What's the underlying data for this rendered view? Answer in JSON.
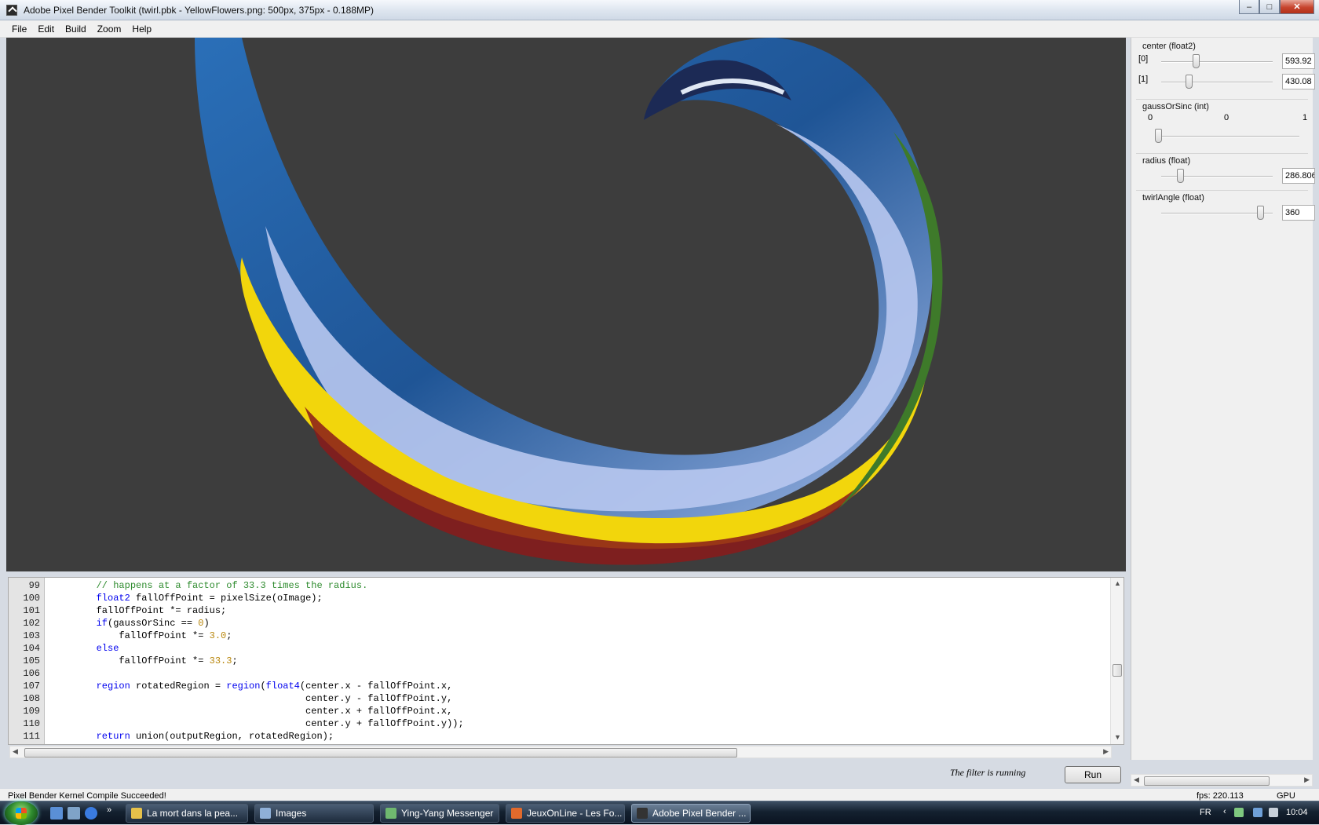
{
  "window": {
    "title": "Adobe Pixel Bender Toolkit (twirl.pbk - YellowFlowers.png: 500px, 375px - 0.188MP)",
    "controls": [
      "–",
      "□",
      "✕"
    ]
  },
  "menu": [
    "File",
    "Edit",
    "Build",
    "Zoom",
    "Help"
  ],
  "params": {
    "center": {
      "title": "center (float2)",
      "rows": [
        {
          "index": "[0]",
          "value": "593.92",
          "level": 0.3
        },
        {
          "index": "[1]",
          "value": "430.08",
          "level": 0.23
        }
      ]
    },
    "gaussOrSinc": {
      "title": "gaussOrSinc (int)",
      "min": "0",
      "mid": "0",
      "max": "1",
      "level": 0.0
    },
    "radius": {
      "title": "radius (float)",
      "value": "286.806",
      "level": 0.15
    },
    "twirlAngle": {
      "title": "twirlAngle (float)",
      "value": "360",
      "level": 0.92
    }
  },
  "editor": {
    "lines": [
      {
        "n": "99",
        "code": "        // happens at a factor of 33.3 times the radius."
      },
      {
        "n": "100",
        "code": "        float2 fallOffPoint = pixelSize(oImage);"
      },
      {
        "n": "101",
        "code": "        fallOffPoint *= radius;"
      },
      {
        "n": "102",
        "code": "        if(gaussOrSinc == 0)"
      },
      {
        "n": "103",
        "code": "            fallOffPoint *= 3.0;"
      },
      {
        "n": "104",
        "code": "        else"
      },
      {
        "n": "105",
        "code": "            fallOffPoint *= 33.3;"
      },
      {
        "n": "106",
        "code": ""
      },
      {
        "n": "107",
        "code": "        region rotatedRegion = region(float4(center.x - fallOffPoint.x,"
      },
      {
        "n": "108",
        "code": "                                             center.y - fallOffPoint.y,"
      },
      {
        "n": "109",
        "code": "                                             center.x + fallOffPoint.x,"
      },
      {
        "n": "110",
        "code": "                                             center.y + fallOffPoint.y));"
      },
      {
        "n": "111",
        "code": "        return union(outputRegion, rotatedRegion);"
      }
    ]
  },
  "run": {
    "status": "The filter is running",
    "button": "Run"
  },
  "status": {
    "message": "Pixel Bender Kernel Compile Succeeded!",
    "fps": "fps: 220.113",
    "device": "GPU"
  },
  "taskbar": {
    "tasks": [
      {
        "label": "La mort dans la pea...",
        "color": "#e6c14a"
      },
      {
        "label": "Images",
        "color": "#8fb0d8"
      },
      {
        "label": "Ying-Yang Messenger",
        "color": "#6fb86f"
      },
      {
        "label": "JeuxOnLine - Les Fo...",
        "color": "#e26a2c"
      },
      {
        "label": "Adobe Pixel Bender ...",
        "color": "#333333"
      }
    ],
    "lang": "FR",
    "clock": "10:04"
  }
}
